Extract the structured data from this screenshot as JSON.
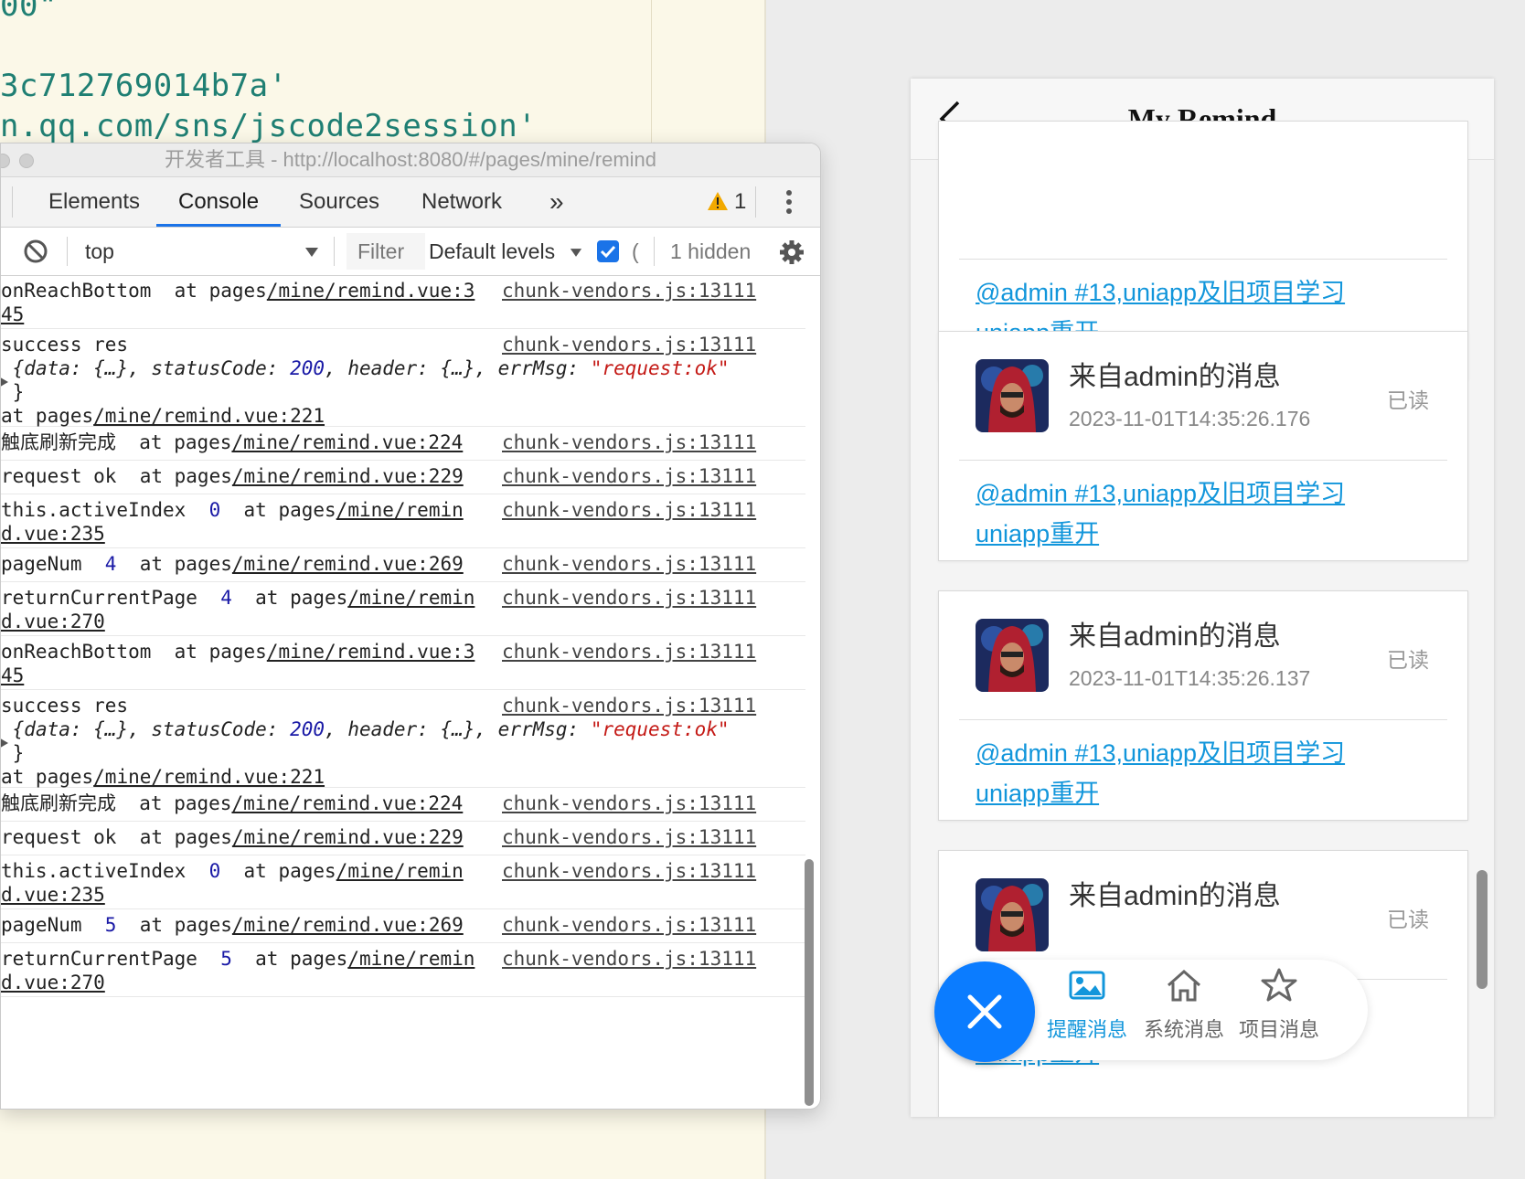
{
  "editor": {
    "lines": [
      "00\"",
      "3c712769014b7a'",
      "n.qq.com/sns/jscode2session'"
    ]
  },
  "devtools": {
    "window_title": "开发者工具 - http://localhost:8080/#/pages/mine/remind",
    "tabs": [
      "Elements",
      "Console",
      "Sources",
      "Network"
    ],
    "active_tab": "Console",
    "more_tabs": "»",
    "warning_count": "1",
    "toolbar": {
      "context": "top",
      "filter_placeholder": "Filter",
      "levels": "Default levels",
      "hidden": "1 hidden"
    },
    "logs": [
      {
        "msg": "onReachBottom  at pages",
        "path": "/mine/remind.vue:3",
        "cont": "45",
        "src": "chunk-vendors.js:13111"
      },
      {
        "msg": "success res",
        "src": "chunk-vendors.js:13111",
        "obj": {
          "a": "{data: {…}, statusCode: ",
          "code": "200",
          "b": ", header: {…}, errMsg: ",
          "err": "\"request:ok\"",
          "close": "}"
        },
        "at": "at pages",
        "at_path": "/mine/remind.vue:221"
      },
      {
        "msg": "触底刷新完成  at pages",
        "path": "/mine/remind.vue:224",
        "src": "chunk-vendors.js:13111"
      },
      {
        "msg": "request ok  at pages",
        "path": "/mine/remind.vue:229",
        "src": "chunk-vendors.js:13111"
      },
      {
        "msg": "this.activeIndex  ",
        "val": "0",
        "msg2": "  at pages",
        "path": "/mine/remin",
        "cont": "d.vue:235",
        "src": "chunk-vendors.js:13111"
      },
      {
        "msg": "pageNum  ",
        "val": "4",
        "msg2": "  at pages",
        "path": "/mine/remind.vue:269",
        "src": "chunk-vendors.js:13111"
      },
      {
        "msg": "returnCurrentPage  ",
        "val": "4",
        "msg2": "  at pages",
        "path": "/mine/remin",
        "cont": "d.vue:270",
        "src": "chunk-vendors.js:13111"
      },
      {
        "msg": "onReachBottom  at pages",
        "path": "/mine/remind.vue:3",
        "cont": "45",
        "src": "chunk-vendors.js:13111"
      },
      {
        "msg": "success res",
        "src": "chunk-vendors.js:13111",
        "obj": {
          "a": "{data: {…}, statusCode: ",
          "code": "200",
          "b": ", header: {…}, errMsg: ",
          "err": "\"request:ok\"",
          "close": "}"
        },
        "at": "at pages",
        "at_path": "/mine/remind.vue:221"
      },
      {
        "msg": "触底刷新完成  at pages",
        "path": "/mine/remind.vue:224",
        "src": "chunk-vendors.js:13111"
      },
      {
        "msg": "request ok  at pages",
        "path": "/mine/remind.vue:229",
        "src": "chunk-vendors.js:13111"
      },
      {
        "msg": "this.activeIndex  ",
        "val": "0",
        "msg2": "  at pages",
        "path": "/mine/remin",
        "cont": "d.vue:235",
        "src": "chunk-vendors.js:13111"
      },
      {
        "msg": "pageNum  ",
        "val": "5",
        "msg2": "  at pages",
        "path": "/mine/remind.vue:269",
        "src": "chunk-vendors.js:13111"
      },
      {
        "msg": "returnCurrentPage  ",
        "val": "5",
        "msg2": "  at pages",
        "path": "/mine/remin",
        "cont": "d.vue:270",
        "src": "chunk-vendors.js:13111"
      }
    ]
  },
  "phone": {
    "title": "My Remind",
    "cards": [
      {
        "sender": "",
        "time": "",
        "status": "",
        "link1": "@admin #13,uniapp及旧项目学习",
        "link2": "uniapp重开"
      },
      {
        "sender": "来自admin的消息",
        "time": "2023-11-01T14:35:26.176",
        "status": "已读",
        "link1": "@admin #13,uniapp及旧项目学习",
        "link2": "uniapp重开"
      },
      {
        "sender": "来自admin的消息",
        "time": "2023-11-01T14:35:26.137",
        "status": "已读",
        "link1": "@admin #13,uniapp及旧项目学习",
        "link2": "uniapp重开"
      },
      {
        "sender": "来自admin的消息",
        "time": "",
        "status": "已读",
        "link1": "",
        "link2": "uniapp重开"
      }
    ],
    "tabbar": [
      {
        "label": "提醒消息",
        "icon": "image-icon"
      },
      {
        "label": "系统消息",
        "icon": "home-icon"
      },
      {
        "label": "项目消息",
        "icon": "star-icon"
      }
    ],
    "accent": "#1296db",
    "fab_color": "#0b7cff"
  }
}
